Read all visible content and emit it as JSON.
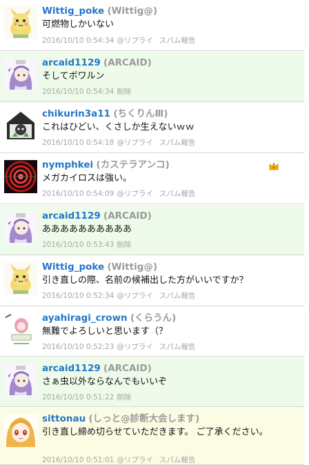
{
  "posts": [
    {
      "username": "Wittig_poke",
      "display_name": "(Wittig@)",
      "text": "可燃物しかいない",
      "time": "2016/10/10 0:54:34",
      "actions": [
        "@リプライ",
        "スパム報告"
      ],
      "avatar": "yellow-creature",
      "variant": "normal"
    },
    {
      "username": "arcaid1129",
      "display_name": "(ARCAID)",
      "text": "そしてボワルン",
      "time": "2016/10/10 0:54:34",
      "actions": [
        "削除"
      ],
      "avatar": "purple-hair-girl",
      "variant": "self"
    },
    {
      "username": "chikurin3a11",
      "display_name": "(ちくりんⅢ)",
      "text": "これはひどい、くさしか生えないｗｗ",
      "time": "2016/10/10 0:54:18",
      "actions": [
        "@リプライ",
        "スパム報告"
      ],
      "avatar": "dark-house-creature",
      "variant": "normal"
    },
    {
      "username": "nymphkei",
      "display_name": "(カステラアンコ)",
      "text": "メガカイロスは強い。",
      "time": "2016/10/10 0:54:09",
      "actions": [
        "@リプライ",
        "スパム報告"
      ],
      "avatar": "red-spiral",
      "variant": "normal",
      "badge": "crown-icon"
    },
    {
      "username": "arcaid1129",
      "display_name": "(ARCAID)",
      "text": "ああああああああああ",
      "time": "2016/10/10 0:53:43",
      "actions": [
        "削除"
      ],
      "avatar": "purple-hair-girl",
      "variant": "self"
    },
    {
      "username": "Wittig_poke",
      "display_name": "(Wittig@)",
      "text": "引き直しの際、名前の候補出した方がいいですか？",
      "time": "2016/10/10 0:52:34",
      "actions": [
        "@リプライ",
        "スパム報告"
      ],
      "avatar": "yellow-creature",
      "variant": "normal"
    },
    {
      "username": "ayahiragi_crown",
      "display_name": "(くらうん)",
      "text": "無難でよろしいと思います（？",
      "time": "2016/10/10 0:52:23",
      "actions": [
        "@リプライ",
        "スパム報告"
      ],
      "avatar": "pink-character",
      "variant": "normal"
    },
    {
      "username": "arcaid1129",
      "display_name": "(ARCAID)",
      "text": "さぁ虫以外ならなんでもいいぞ",
      "time": "2016/10/10 0:51:22",
      "actions": [
        "削除"
      ],
      "avatar": "purple-hair-girl",
      "variant": "self"
    },
    {
      "username": "sittonau",
      "display_name": "(しっと@診断大会します)",
      "text": "引き直し締め切らせていただきます。 ご了承ください。",
      "time": "2016/10/10 0:51:01",
      "actions": [
        "@リプライ",
        "スパム報告"
      ],
      "avatar": "blonde-girl",
      "variant": "highlight"
    }
  ]
}
